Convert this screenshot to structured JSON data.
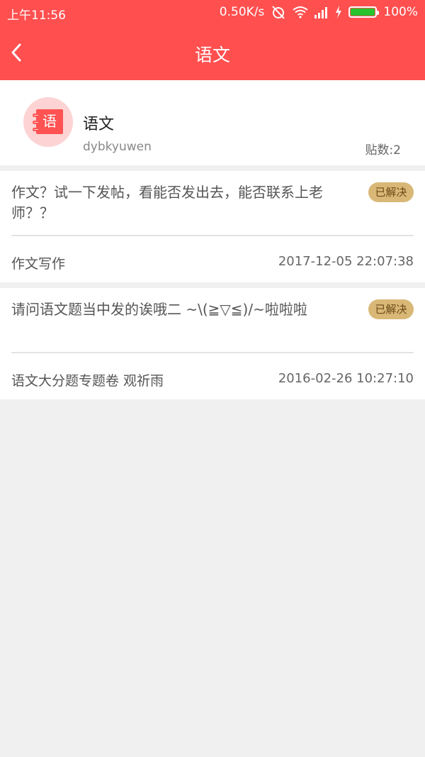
{
  "status_bar": {
    "time": "上午11:56",
    "network_speed": "0.50K/s",
    "battery_percent": "100%",
    "icons": [
      "alarm-off-icon",
      "wifi-icon",
      "signal-icon",
      "charging-icon",
      "battery-icon"
    ]
  },
  "nav": {
    "back_icon": "chevron-left-icon",
    "title": "语文"
  },
  "forum": {
    "icon_text": "语",
    "name": "语文",
    "code": "dybkyuwen",
    "post_count": "贴数:2"
  },
  "posts": [
    {
      "title": "作文？试一下发帖，看能否发出去，能否联系上老师？？",
      "status": "已解决",
      "board": "作文写作",
      "date": "2017-12-05 22:07:38"
    },
    {
      "title": "请问语文题当中发的诶哦二 ~\\(≧▽≦)/~啦啦啦",
      "status": "已解决",
      "board": "语文大分题专题卷  观祈雨",
      "date": "2016-02-26 10:27:10"
    }
  ],
  "colors": {
    "primary": "#ff4f4f",
    "badge": "#d9b877",
    "page_background": "#f0f0f0"
  }
}
